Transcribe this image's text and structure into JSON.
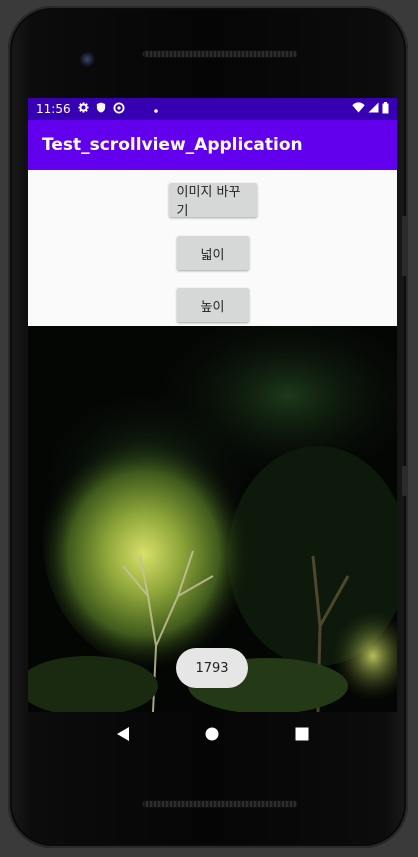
{
  "status_bar": {
    "time": "11:56",
    "icons": [
      "gear-icon",
      "shield-icon",
      "sync-icon",
      "dot-icon",
      "wifi-icon",
      "signal-icon",
      "battery-icon"
    ]
  },
  "app_bar": {
    "title": "Test_scrollview_Application"
  },
  "buttons": {
    "change_image": "이미지 바꾸기",
    "width": "넓이",
    "height": "높이"
  },
  "toast": {
    "text": "1793"
  },
  "nav_bar": {
    "icons": [
      "back-icon",
      "home-icon",
      "recents-icon"
    ]
  },
  "colors": {
    "status_bar": "#3700b3",
    "app_bar": "#6200ee",
    "button": "#d6d7d7",
    "content_bg": "#fafafa"
  }
}
